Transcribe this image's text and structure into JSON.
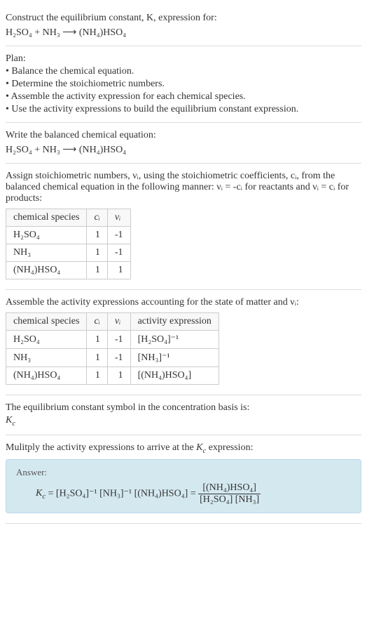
{
  "intro": {
    "prompt": "Construct the equilibrium constant, K, expression for:",
    "equation": "H₂SO₄ + NH₃  ⟶  (NH₄)HSO₄"
  },
  "plan": {
    "heading": "Plan:",
    "steps": [
      "• Balance the chemical equation.",
      "• Determine the stoichiometric numbers.",
      "• Assemble the activity expression for each chemical species.",
      "• Use the activity expressions to build the equilibrium constant expression."
    ]
  },
  "balanced": {
    "heading": "Write the balanced chemical equation:",
    "equation": "H₂SO₄ + NH₃  ⟶  (NH₄)HSO₄"
  },
  "stoich": {
    "text1": "Assign stoichiometric numbers, νᵢ, using the stoichiometric coefficients, cᵢ, from the balanced chemical equation in the following manner: νᵢ = -cᵢ for reactants and νᵢ = cᵢ for products:",
    "headers": {
      "species": "chemical species",
      "ci": "cᵢ",
      "vi": "νᵢ"
    },
    "rows": [
      {
        "species": "H₂SO₄",
        "ci": "1",
        "vi": "-1"
      },
      {
        "species": "NH₃",
        "ci": "1",
        "vi": "-1"
      },
      {
        "species": "(NH₄)HSO₄",
        "ci": "1",
        "vi": "1"
      }
    ]
  },
  "activity": {
    "heading": "Assemble the activity expressions accounting for the state of matter and νᵢ:",
    "headers": {
      "species": "chemical species",
      "ci": "cᵢ",
      "vi": "νᵢ",
      "expr": "activity expression"
    },
    "rows": [
      {
        "species": "H₂SO₄",
        "ci": "1",
        "vi": "-1",
        "expr": "[H₂SO₄]⁻¹"
      },
      {
        "species": "NH₃",
        "ci": "1",
        "vi": "-1",
        "expr": "[NH₃]⁻¹"
      },
      {
        "species": "(NH₄)HSO₄",
        "ci": "1",
        "vi": "1",
        "expr": "[(NH₄)HSO₄]"
      }
    ]
  },
  "symbol": {
    "text": "The equilibrium constant symbol in the concentration basis is:",
    "value": "K_c"
  },
  "final": {
    "heading": "Mulitply the activity expressions to arrive at the K_c expression:",
    "answer_label": "Answer:",
    "lhs": "K_c = [H₂SO₄]⁻¹ [NH₃]⁻¹ [(NH₄)HSO₄] =",
    "frac_num": "[(NH₄)HSO₄]",
    "frac_den": "[H₂SO₄] [NH₃]"
  },
  "chart_data": {
    "type": "table",
    "tables": [
      {
        "title": "Stoichiometric numbers",
        "columns": [
          "chemical species",
          "cᵢ",
          "νᵢ"
        ],
        "rows": [
          [
            "H₂SO₄",
            1,
            -1
          ],
          [
            "NH₃",
            1,
            -1
          ],
          [
            "(NH₄)HSO₄",
            1,
            1
          ]
        ]
      },
      {
        "title": "Activity expressions",
        "columns": [
          "chemical species",
          "cᵢ",
          "νᵢ",
          "activity expression"
        ],
        "rows": [
          [
            "H₂SO₄",
            1,
            -1,
            "[H₂SO₄]⁻¹"
          ],
          [
            "NH₃",
            1,
            -1,
            "[NH₃]⁻¹"
          ],
          [
            "(NH₄)HSO₄",
            1,
            1,
            "[(NH₄)HSO₄]"
          ]
        ]
      }
    ]
  }
}
